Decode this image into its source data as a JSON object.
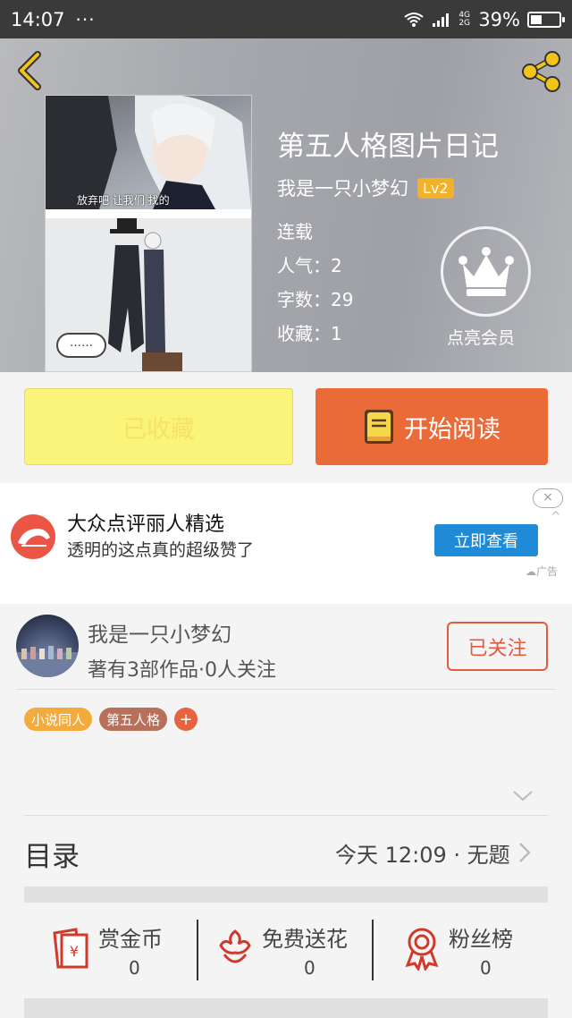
{
  "status_bar": {
    "time": "14:07",
    "dots": "···",
    "network": "4G 2G",
    "battery": "39%",
    "battery_level": 0.39
  },
  "header": {
    "title": "第五人格图片日记",
    "author": "我是一只小梦幻",
    "level": "Lv2",
    "status": "连载",
    "popularity": "人气：2",
    "word_count": "字数：29",
    "favorites": "收藏：1",
    "vip_label": "点亮会员",
    "cover_caption": "放弃吧  让我们  找的",
    "cover_bubble": "……"
  },
  "actions": {
    "collected_label": "已收藏",
    "read_label": "开始阅读"
  },
  "ad": {
    "title": "大众点评丽人精选",
    "description": "透明的这点真的超级赞了",
    "cta": "立即查看",
    "close": "×",
    "collapse": "^",
    "mark": "广告"
  },
  "author_card": {
    "name": "我是一只小梦幻",
    "works": "著有3部作品·0人关注",
    "follow_label": "已关注"
  },
  "tags": [
    {
      "label": "小说同人",
      "color": "#f3ac3b"
    },
    {
      "label": "第五人格",
      "color": "#b8705a"
    }
  ],
  "tag_add": "+",
  "toc": {
    "label": "目录",
    "latest": "今天 12:09 · 无题"
  },
  "stats": [
    {
      "label": "赏金币",
      "value": "0"
    },
    {
      "label": "免费送花",
      "value": "0"
    },
    {
      "label": "粉丝榜",
      "value": "0"
    }
  ],
  "colors": {
    "accent_orange": "#ea6b38",
    "collected_yellow": "#fbf47a",
    "follow_red": "#e25a3f",
    "icon_red": "#d03a2a",
    "icon_yellow": "#f3ac3b"
  }
}
